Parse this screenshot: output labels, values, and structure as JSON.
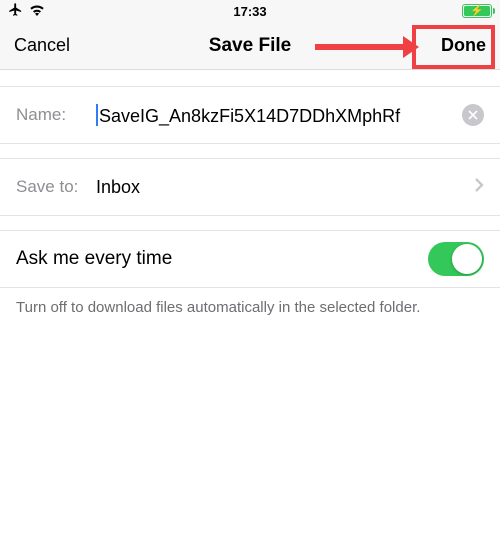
{
  "status": {
    "time": "17:33"
  },
  "nav": {
    "cancel": "Cancel",
    "title": "Save File",
    "done": "Done"
  },
  "nameRow": {
    "label": "Name:",
    "value": "SaveIG_An8kzFi5X14D7DDhXMphRf"
  },
  "saveRow": {
    "label": "Save to:",
    "value": "Inbox"
  },
  "askRow": {
    "label": "Ask me every time",
    "switchOn": true
  },
  "hint": "Turn off to download files automatically in the selected folder.",
  "colors": {
    "annotation": "#ef4043",
    "switch": "#34c759"
  }
}
